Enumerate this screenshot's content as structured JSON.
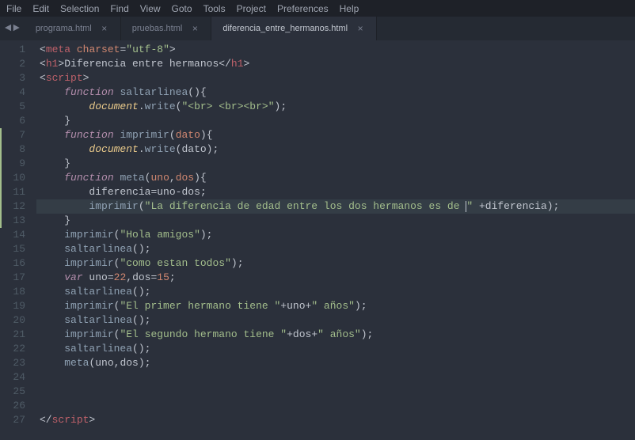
{
  "menu": {
    "items": [
      "File",
      "Edit",
      "Selection",
      "Find",
      "View",
      "Goto",
      "Tools",
      "Project",
      "Preferences",
      "Help"
    ]
  },
  "nav": {
    "left": "◄",
    "right": "►"
  },
  "tabs": [
    {
      "label": "programa.html",
      "active": false
    },
    {
      "label": "pruebas.html",
      "active": false
    },
    {
      "label": "diferencia_entre_hermanos.html",
      "active": true
    }
  ],
  "editor": {
    "highlight_line": 12,
    "modified_lines": [
      7,
      8,
      9,
      10,
      11,
      12,
      13
    ],
    "line_count": 27,
    "lines": [
      {
        "n": 1,
        "seg": [
          [
            "p",
            "<"
          ],
          [
            "tg",
            "meta"
          ],
          [
            "p",
            " "
          ],
          [
            "at",
            "charset"
          ],
          [
            "p",
            "="
          ],
          [
            "st",
            "\"utf-8\""
          ],
          [
            "p",
            ">"
          ]
        ]
      },
      {
        "n": 2,
        "seg": [
          [
            "p",
            "<"
          ],
          [
            "tg",
            "h1"
          ],
          [
            "p",
            ">"
          ],
          [
            "p",
            "Diferencia entre hermanos"
          ],
          [
            "p",
            "</"
          ],
          [
            "tg",
            "h1"
          ],
          [
            "p",
            ">"
          ]
        ]
      },
      {
        "n": 3,
        "seg": [
          [
            "p",
            "<"
          ],
          [
            "tg",
            "script"
          ],
          [
            "p",
            ">"
          ]
        ]
      },
      {
        "n": 4,
        "seg": [
          [
            "p",
            "    "
          ],
          [
            "kw it",
            "function"
          ],
          [
            "p",
            " "
          ],
          [
            "fn",
            "saltarlinea"
          ],
          [
            "p",
            "(){"
          ]
        ]
      },
      {
        "n": 5,
        "seg": [
          [
            "p",
            "        "
          ],
          [
            "ob it",
            "document"
          ],
          [
            "p",
            "."
          ],
          [
            "fn",
            "write"
          ],
          [
            "p",
            "("
          ],
          [
            "st",
            "\"<br> <br><br>\""
          ],
          [
            "p",
            ");"
          ]
        ]
      },
      {
        "n": 6,
        "seg": [
          [
            "p",
            "    }"
          ]
        ]
      },
      {
        "n": 7,
        "seg": [
          [
            "p",
            "    "
          ],
          [
            "kw it",
            "function"
          ],
          [
            "p",
            " "
          ],
          [
            "fn",
            "imprimir"
          ],
          [
            "p",
            "("
          ],
          [
            "at",
            "dato"
          ],
          [
            "p",
            "){"
          ]
        ]
      },
      {
        "n": 8,
        "seg": [
          [
            "p",
            "        "
          ],
          [
            "ob it",
            "document"
          ],
          [
            "p",
            "."
          ],
          [
            "fn",
            "write"
          ],
          [
            "p",
            "(dato);"
          ]
        ]
      },
      {
        "n": 9,
        "seg": [
          [
            "p",
            "    }"
          ]
        ]
      },
      {
        "n": 10,
        "seg": [
          [
            "p",
            "    "
          ],
          [
            "kw it",
            "function"
          ],
          [
            "p",
            " "
          ],
          [
            "fn",
            "meta"
          ],
          [
            "p",
            "("
          ],
          [
            "at",
            "uno"
          ],
          [
            "p",
            ","
          ],
          [
            "at",
            "dos"
          ],
          [
            "p",
            "){"
          ]
        ]
      },
      {
        "n": 11,
        "seg": [
          [
            "p",
            "        "
          ],
          [
            "p",
            "diferencia"
          ],
          [
            "op",
            "="
          ],
          [
            "p",
            "uno"
          ],
          [
            "op",
            "-"
          ],
          [
            "p",
            "dos;"
          ]
        ]
      },
      {
        "n": 12,
        "seg": [
          [
            "p",
            "        "
          ],
          [
            "fn",
            "imprimir"
          ],
          [
            "p",
            "("
          ],
          [
            "st",
            "\"La diferencia de edad entre los dos hermanos es de "
          ],
          [
            "cursor",
            ""
          ],
          [
            "st",
            "\""
          ],
          [
            "p",
            " "
          ],
          [
            "op",
            "+"
          ],
          [
            "p",
            "diferencia"
          ],
          [
            "p",
            ")"
          ],
          [
            "p",
            ";"
          ]
        ]
      },
      {
        "n": 13,
        "seg": [
          [
            "p",
            "    }"
          ]
        ]
      },
      {
        "n": 14,
        "seg": [
          [
            "p",
            "    "
          ],
          [
            "fn",
            "imprimir"
          ],
          [
            "p",
            "("
          ],
          [
            "st",
            "\"Hola amigos\""
          ],
          [
            "p",
            ");"
          ]
        ]
      },
      {
        "n": 15,
        "seg": [
          [
            "p",
            "    "
          ],
          [
            "fn",
            "saltarlinea"
          ],
          [
            "p",
            "();"
          ]
        ]
      },
      {
        "n": 16,
        "seg": [
          [
            "p",
            "    "
          ],
          [
            "fn",
            "imprimir"
          ],
          [
            "p",
            "("
          ],
          [
            "st",
            "\"como estan todos\""
          ],
          [
            "p",
            ");"
          ]
        ]
      },
      {
        "n": 17,
        "seg": [
          [
            "p",
            "    "
          ],
          [
            "kw it",
            "var"
          ],
          [
            "p",
            " uno"
          ],
          [
            "op",
            "="
          ],
          [
            "nm",
            "22"
          ],
          [
            "p",
            ",dos"
          ],
          [
            "op",
            "="
          ],
          [
            "nm",
            "15"
          ],
          [
            "p",
            ";"
          ]
        ]
      },
      {
        "n": 18,
        "seg": [
          [
            "p",
            "    "
          ],
          [
            "fn",
            "saltarlinea"
          ],
          [
            "p",
            "();"
          ]
        ]
      },
      {
        "n": 19,
        "seg": [
          [
            "p",
            "    "
          ],
          [
            "fn",
            "imprimir"
          ],
          [
            "p",
            "("
          ],
          [
            "st",
            "\"El primer hermano tiene \""
          ],
          [
            "op",
            "+"
          ],
          [
            "p",
            "uno"
          ],
          [
            "op",
            "+"
          ],
          [
            "st",
            "\" años\""
          ],
          [
            "p",
            ");"
          ]
        ]
      },
      {
        "n": 20,
        "seg": [
          [
            "p",
            "    "
          ],
          [
            "fn",
            "saltarlinea"
          ],
          [
            "p",
            "();"
          ]
        ]
      },
      {
        "n": 21,
        "seg": [
          [
            "p",
            "    "
          ],
          [
            "fn",
            "imprimir"
          ],
          [
            "p",
            "("
          ],
          [
            "st",
            "\"El segundo hermano tiene \""
          ],
          [
            "op",
            "+"
          ],
          [
            "p",
            "dos"
          ],
          [
            "op",
            "+"
          ],
          [
            "st",
            "\" años\""
          ],
          [
            "p",
            ");"
          ]
        ]
      },
      {
        "n": 22,
        "seg": [
          [
            "p",
            "    "
          ],
          [
            "fn",
            "saltarlinea"
          ],
          [
            "p",
            "();"
          ]
        ]
      },
      {
        "n": 23,
        "seg": [
          [
            "p",
            "    "
          ],
          [
            "fn",
            "meta"
          ],
          [
            "p",
            "(uno,dos);"
          ]
        ]
      },
      {
        "n": 24,
        "seg": []
      },
      {
        "n": 25,
        "seg": []
      },
      {
        "n": 26,
        "seg": []
      },
      {
        "n": 27,
        "seg": [
          [
            "p",
            "</"
          ],
          [
            "tg",
            "script"
          ],
          [
            "p",
            ">"
          ]
        ]
      }
    ]
  }
}
